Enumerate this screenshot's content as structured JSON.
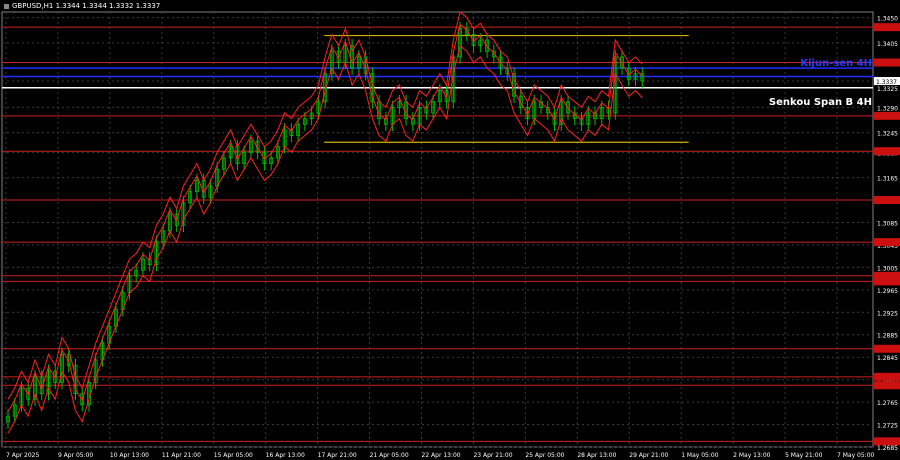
{
  "header": {
    "title": "GBPUSD,H1  1.3344 1.3344 1.3332 1.3337"
  },
  "annotations": {
    "kijun": "Kijun-sen 4H",
    "senkou": "Senkou Span B 4H"
  },
  "colors": {
    "background": "#000000",
    "grid": "#3a3a3a",
    "candle": "#00c000",
    "ichimoku": "#ff2020",
    "resistance": "#cc2020",
    "range": "#d4b000",
    "kijun": "#1f2fff",
    "senkou": "#ffffff",
    "price_label_bg": "#cc1010",
    "current_price_bg": "#ffffff"
  },
  "chart_data": {
    "type": "candlestick",
    "symbol": "GBPUSD",
    "timeframe": "H1",
    "ohlc": {
      "open": "1.3344",
      "high": "1.3344",
      "low": "1.3332",
      "close": "1.3337"
    },
    "ylim": [
      1.2685,
      1.346
    ],
    "y_ticks": [
      "1.3450",
      "1.3405",
      "1.3370",
      "1.3337",
      "1.3325",
      "1.3290",
      "1.3245",
      "1.3210",
      "1.3165",
      "1.3125",
      "1.3085",
      "1.3045",
      "1.3005",
      "1.2965",
      "1.2925",
      "1.2885",
      "1.2845",
      "1.2805",
      "1.2765",
      "1.2725",
      "1.2685"
    ],
    "x_ticks": [
      "7 Apr 2025",
      "9 Apr 05:00",
      "10 Apr 13:00",
      "11 Apr 21:00",
      "15 Apr 05:00",
      "16 Apr 13:00",
      "17 Apr 21:00",
      "21 Apr 05:00",
      "22 Apr 13:00",
      "23 Apr 21:00",
      "25 Apr 05:00",
      "28 Apr 13:00",
      "29 Apr 21:00",
      "1 May 05:00",
      "2 May 13:00",
      "5 May 21:00",
      "7 May 05:00"
    ],
    "price_levels": [
      1.3433,
      1.337,
      1.3275,
      1.3212,
      1.3125,
      1.305,
      1.299,
      1.298,
      1.286,
      1.281,
      1.2795,
      1.2695
    ],
    "range_lines": [
      {
        "price": 1.3418,
        "from_x": 0.37,
        "to_x": 0.995
      },
      {
        "price": 1.3228,
        "from_x": 0.37,
        "to_x": 0.995
      }
    ],
    "kijun_4h": [
      1.336,
      1.3345
    ],
    "senkou_b_4h": 1.3325,
    "current_price": 1.3337,
    "closes": [
      1.274,
      1.276,
      1.279,
      1.277,
      1.281,
      1.278,
      1.282,
      1.28,
      1.285,
      1.283,
      1.278,
      1.276,
      1.28,
      1.284,
      1.287,
      1.29,
      1.293,
      1.296,
      1.299,
      1.3,
      1.302,
      1.301,
      1.305,
      1.307,
      1.31,
      1.308,
      1.312,
      1.314,
      1.316,
      1.313,
      1.315,
      1.318,
      1.32,
      1.322,
      1.319,
      1.321,
      1.323,
      1.321,
      1.319,
      1.32,
      1.322,
      1.325,
      1.324,
      1.326,
      1.327,
      1.328,
      1.33,
      1.335,
      1.339,
      1.337,
      1.34,
      1.336,
      1.338,
      1.335,
      1.33,
      1.327,
      1.326,
      1.329,
      1.33,
      1.327,
      1.326,
      1.329,
      1.328,
      1.33,
      1.332,
      1.33,
      1.338,
      1.343,
      1.342,
      1.34,
      1.341,
      1.339,
      1.338,
      1.336,
      1.335,
      1.331,
      1.329,
      1.327,
      1.33,
      1.329,
      1.328,
      1.326,
      1.33,
      1.328,
      1.327,
      1.326,
      1.328,
      1.327,
      1.329,
      1.328,
      1.338,
      1.336,
      1.334,
      1.335,
      1.3337
    ]
  }
}
